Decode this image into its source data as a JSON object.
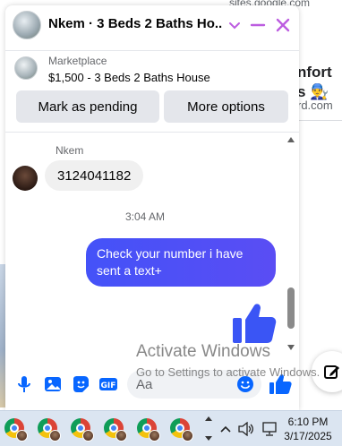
{
  "background_page": {
    "url_fragment": "sites.google.com",
    "right_title_line1": "nfort",
    "right_title_line2": "s 👨‍🔧",
    "right_sub": "rd.com"
  },
  "chat": {
    "title": "Nkem · 3 Beds 2 Baths Ho...",
    "listing": {
      "label": "Marketplace",
      "title": "$1,500 - 3 Beds 2 Baths House",
      "pending_button": "Mark as pending",
      "more_button": "More options"
    },
    "messages": {
      "sender_name": "Nkem",
      "incoming_text": "3124041182",
      "timestamp": "3:04 AM",
      "outgoing_text": "Check your number i have sent a text+"
    },
    "composer": {
      "placeholder": "Aa"
    }
  },
  "watermark": {
    "line1": "Activate Windows",
    "line2": "Go to Settings to activate Windows."
  },
  "taskbar": {
    "time": "6:10 PM",
    "date": "3/17/2025",
    "app_count": 6
  },
  "colors": {
    "accent": "#0866ff",
    "outgoing_bubble": "#4452f8",
    "header_icons": "#bc5ce0"
  },
  "icons": [
    "chevron-down-icon",
    "minimize-icon",
    "close-icon",
    "microphone-icon",
    "photo-icon",
    "sticker-icon",
    "gif-icon",
    "emoji-icon",
    "like-icon",
    "edit-icon",
    "chrome-icon",
    "volume-icon",
    "network-icon"
  ]
}
